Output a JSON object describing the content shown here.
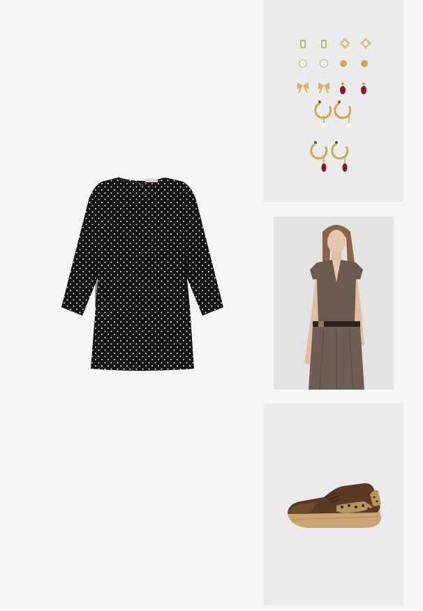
{
  "collage": {
    "items": [
      {
        "id": "dress",
        "icon": "polka-dot-dress-image"
      },
      {
        "id": "jewelry",
        "icon": "earring-set-image"
      },
      {
        "id": "model",
        "icon": "brown-vest-trousers-outfit-image"
      },
      {
        "id": "shoe",
        "icon": "brown-leopard-sneaker-image"
      }
    ]
  },
  "colors": {
    "page_background": "#f6f6f6",
    "tile_background": "#e9e9e9",
    "dress": "#141414",
    "gold": "#d4a64a",
    "garnet": "#8e1620",
    "suit_brown": "#6b5a4f",
    "shoe_brown": "#5a3a22",
    "sole_tan": "#c9a574"
  }
}
